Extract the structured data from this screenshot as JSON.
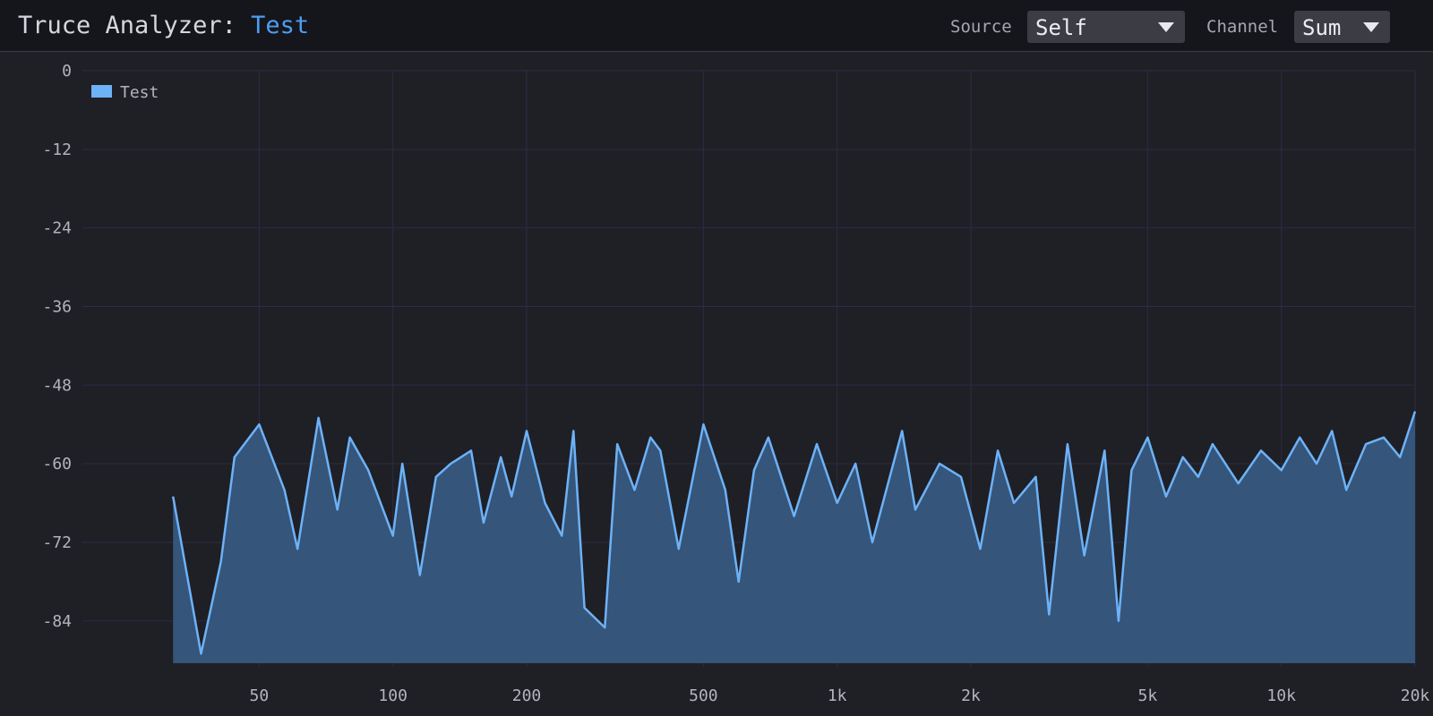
{
  "header": {
    "title_prefix": "Truce Analyzer: ",
    "title_name": "Test",
    "source_label": "Source",
    "source_value": "Self",
    "channel_label": "Channel",
    "channel_value": "Sum"
  },
  "colors": {
    "background": "#1f1f26",
    "header_background": "#15151c",
    "accent": "#4d9ef0",
    "series_line": "#6db2f7",
    "series_fill": "#35557a",
    "grid": "#2c2c44"
  },
  "chart_data": {
    "type": "area",
    "x_scale": "log",
    "xlim": [
      20,
      20000
    ],
    "ylim": [
      -91,
      0
    ],
    "grid": true,
    "legend_position": "top-left",
    "x_ticks": [
      50,
      100,
      200,
      500,
      1000,
      2000,
      5000,
      10000,
      20000
    ],
    "x_tick_labels": [
      "50",
      "100",
      "200",
      "500",
      "1k",
      "2k",
      "5k",
      "10k",
      "20k"
    ],
    "y_ticks": [
      0,
      -12,
      -24,
      -36,
      -48,
      -60,
      -72,
      -84
    ],
    "y_tick_labels": [
      "0",
      "-12",
      "-24",
      "-36",
      "-48",
      "-60",
      "-72",
      "-84"
    ],
    "series": [
      {
        "name": "Test",
        "x": [
          32,
          37,
          41,
          44,
          50,
          57,
          61,
          68,
          75,
          80,
          88,
          100,
          105,
          115,
          125,
          135,
          150,
          160,
          175,
          185,
          200,
          220,
          240,
          255,
          270,
          300,
          320,
          350,
          380,
          400,
          440,
          500,
          560,
          600,
          650,
          700,
          800,
          900,
          1000,
          1100,
          1200,
          1400,
          1500,
          1700,
          1900,
          2100,
          2300,
          2500,
          2800,
          3000,
          3300,
          3600,
          4000,
          4300,
          4600,
          5000,
          5500,
          6000,
          6500,
          7000,
          8000,
          9000,
          10000,
          11000,
          12000,
          13000,
          14000,
          15500,
          17000,
          18500,
          20000
        ],
        "y": [
          -65,
          -89,
          -75,
          -59,
          -54,
          -64,
          -73,
          -53,
          -67,
          -56,
          -61,
          -71,
          -60,
          -77,
          -62,
          -60,
          -58,
          -69,
          -59,
          -65,
          -55,
          -66,
          -71,
          -55,
          -82,
          -85,
          -57,
          -64,
          -56,
          -58,
          -73,
          -54,
          -64,
          -78,
          -61,
          -56,
          -68,
          -57,
          -66,
          -60,
          -72,
          -55,
          -67,
          -60,
          -62,
          -73,
          -58,
          -66,
          -62,
          -83,
          -57,
          -74,
          -58,
          -84,
          -61,
          -56,
          -65,
          -59,
          -62,
          -57,
          -63,
          -58,
          -61,
          -56,
          -60,
          -55,
          -64,
          -57,
          -56,
          -59,
          -52
        ]
      }
    ]
  }
}
